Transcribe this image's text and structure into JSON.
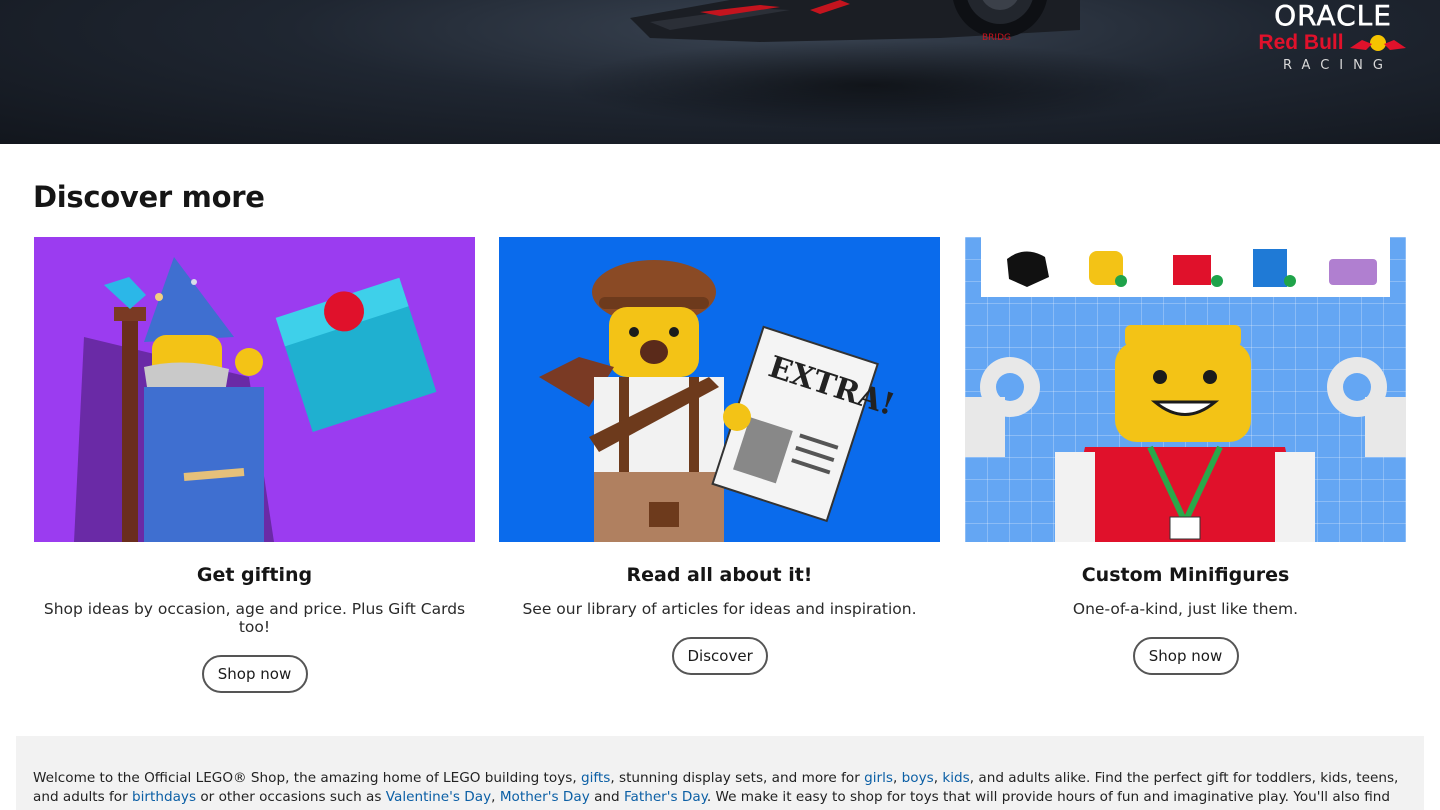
{
  "hero": {
    "sponsor_oracle": "ORACLE",
    "sponsor_redbull": "Red Bull",
    "sponsor_racing": "RACING"
  },
  "discover": {
    "title": "Discover more",
    "cards": [
      {
        "heading": "Get gifting",
        "description": "Shop ideas by occasion, age and price. Plus Gift Cards too!",
        "button": "Shop now"
      },
      {
        "heading": "Read all about it!",
        "description": "See our library of articles for ideas and inspiration.",
        "button": "Discover"
      },
      {
        "heading": "Custom Minifigures",
        "description": "One-of-a-kind, just like them.",
        "button": "Shop now"
      }
    ]
  },
  "seo": {
    "t1": "Welcome to the Official LEGO® Shop, the amazing home of LEGO building toys, ",
    "l_gifts": "gifts",
    "t2": ", stunning display sets, and more for ",
    "l_girls": "girls",
    "t3": ", ",
    "l_boys": "boys",
    "t4": ", ",
    "l_kids": "kids",
    "t5": ", and adults alike. Find the perfect gift for toddlers, kids, teens, and adults for ",
    "l_birthdays": "birthdays",
    "t6": " or other occasions such as ",
    "l_valentines": "Valentine's Day",
    "t7": ", ",
    "l_mothers": "Mother's Day",
    "t8": " and ",
    "l_fathers": "Father's Day",
    "t9": ". We make it easy to shop for toys that will provide hours of fun and imaginative play. You'll also find curated"
  },
  "colors": {
    "link": "#0b5fa5",
    "card1_bg": "#9b3cf0",
    "card2_bg": "#0a6bec",
    "card3_bg": "#64a6f3"
  }
}
